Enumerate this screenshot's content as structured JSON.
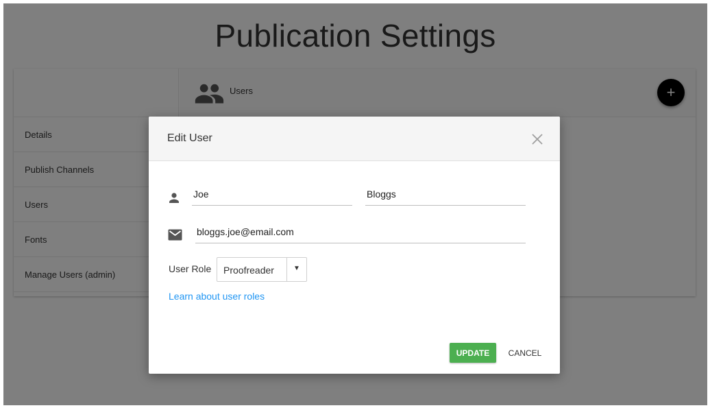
{
  "page": {
    "title": "Publication Settings"
  },
  "sidebar": {
    "items": [
      {
        "label": "Details"
      },
      {
        "label": "Publish Channels"
      },
      {
        "label": "Users"
      },
      {
        "label": "Fonts"
      },
      {
        "label": "Manage Users (admin)"
      }
    ]
  },
  "content_header": {
    "icon": "users-icon",
    "label": "Users",
    "add_button_label": "+"
  },
  "modal": {
    "title": "Edit User",
    "close_icon": "close-icon",
    "first_name": {
      "value": "Joe",
      "icon": "person-icon"
    },
    "last_name": {
      "value": "Bloggs"
    },
    "email": {
      "value": "bloggs.joe@email.com",
      "icon": "mail-icon"
    },
    "role": {
      "label": "User Role",
      "selected": "Proofreader",
      "caret": "▼"
    },
    "learn_link": "Learn about user roles",
    "update_label": "UPDATE",
    "cancel_label": "CANCEL"
  },
  "colors": {
    "accent_green": "#4caf50",
    "link_blue": "#2196f3",
    "fab_black": "#000000"
  }
}
